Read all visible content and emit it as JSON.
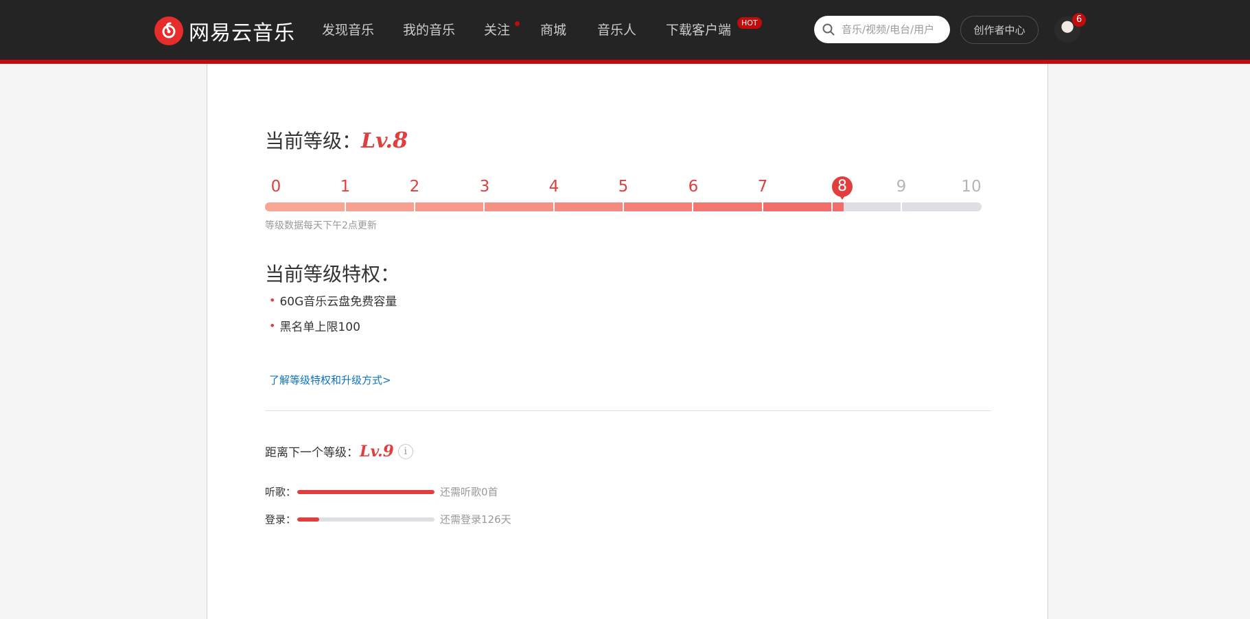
{
  "brand": {
    "name": "网易云音乐"
  },
  "nav": {
    "items": [
      {
        "label": "发现音乐"
      },
      {
        "label": "我的音乐"
      },
      {
        "label": "关注"
      },
      {
        "label": "商城"
      },
      {
        "label": "音乐人"
      },
      {
        "label": "下载客户端"
      }
    ],
    "hot_badge": "HOT"
  },
  "search": {
    "placeholder": "音乐/视频/电台/用户"
  },
  "creator_center": "创作者中心",
  "user": {
    "notification_count": "6"
  },
  "level": {
    "title_prefix": "当前等级：",
    "lv_prefix": "Lv.",
    "current": "8",
    "scale": [
      "0",
      "1",
      "2",
      "3",
      "4",
      "5",
      "6",
      "7",
      "8",
      "9",
      "10"
    ],
    "progress_fraction": 0.81,
    "update_note": "等级数据每天下午2点更新"
  },
  "privileges": {
    "title": "当前等级特权：",
    "items": [
      "60G音乐云盘免费容量",
      "黑名单上限100"
    ],
    "learn_more": "了解等级特权和升级方式>"
  },
  "next_level": {
    "title": "距离下一个等级：",
    "lv_prefix": "Lv.",
    "level": "9",
    "info_icon": "i",
    "requirements": [
      {
        "label": "听歌：",
        "progress": 1.0,
        "note": "还需听歌0首"
      },
      {
        "label": "登录：",
        "progress": 0.16,
        "note": "还需登录126天"
      }
    ]
  },
  "colors": {
    "topbar": "#242424",
    "accent_red": "#c20c0c",
    "level_red": "#e13e3e",
    "link_blue": "#0c73c2"
  }
}
